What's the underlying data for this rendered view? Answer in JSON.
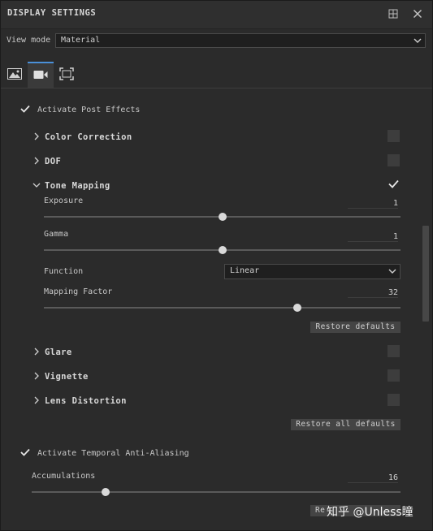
{
  "window": {
    "title": "DISPLAY SETTINGS"
  },
  "view_mode": {
    "label": "View mode",
    "value": "Material"
  },
  "tabs": [
    {
      "icon": "image-icon",
      "active": false
    },
    {
      "icon": "camera-icon",
      "active": true
    },
    {
      "icon": "frame-icon",
      "active": false
    }
  ],
  "post_effects": {
    "label": "Activate Post Effects",
    "checked": true
  },
  "sections": {
    "color_correction": {
      "label": "Color Correction",
      "enabled": false,
      "expanded": false
    },
    "dof": {
      "label": "DOF",
      "enabled": false,
      "expanded": false
    },
    "tone_mapping": {
      "label": "Tone Mapping",
      "enabled": true,
      "expanded": true
    },
    "glare": {
      "label": "Glare",
      "enabled": false,
      "expanded": false
    },
    "vignette": {
      "label": "Vignette",
      "enabled": false,
      "expanded": false
    },
    "lens_distortion": {
      "label": "Lens Distortion",
      "enabled": false,
      "expanded": false
    }
  },
  "tone_mapping": {
    "exposure": {
      "label": "Exposure",
      "value": "1",
      "slider_fraction": 0.5
    },
    "gamma": {
      "label": "Gamma",
      "value": "1",
      "slider_fraction": 0.5
    },
    "function": {
      "label": "Function",
      "value": "Linear"
    },
    "mapping_factor": {
      "label": "Mapping Factor",
      "value": "32",
      "slider_fraction": 0.71
    },
    "restore_label": "Restore defaults"
  },
  "restore_all_label": "Restore all defaults",
  "taa": {
    "label": "Activate Temporal Anti-Aliasing",
    "checked": true
  },
  "accumulations": {
    "label": "Accumulations",
    "value": "16",
    "slider_fraction": 0.2
  },
  "bottom_button": {
    "label": "Re"
  },
  "watermark": {
    "text": "知乎 @Unless瞳"
  }
}
